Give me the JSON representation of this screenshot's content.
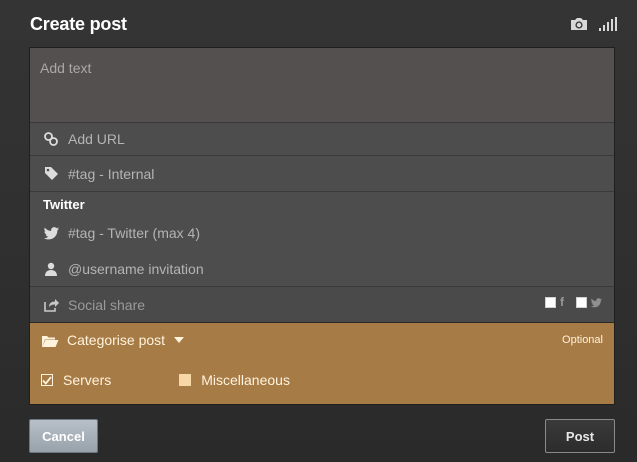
{
  "dialog": {
    "title": "Create post",
    "header_icons": [
      "camera-icon",
      "signal-icon"
    ]
  },
  "form": {
    "text_placeholder": "Add text",
    "url_placeholder": "Add URL",
    "tag_internal_placeholder": "#tag - Internal",
    "twitter": {
      "section_title": "Twitter",
      "tag_placeholder": "#tag - Twitter (max 4)",
      "username_placeholder": "@username invitation"
    },
    "social": {
      "label": "Social share",
      "facebook_icon_glyph": "f",
      "facebook_checked": false,
      "twitter_checked": false
    },
    "category": {
      "label": "Categorise post",
      "optional_label": "Optional",
      "options": [
        {
          "label": "Servers",
          "checked": true
        },
        {
          "label": "Miscellaneous",
          "checked": false
        }
      ]
    }
  },
  "actions": {
    "cancel_label": "Cancel",
    "post_label": "Post"
  },
  "colors": {
    "category_background": "#a67b46",
    "panel_background": "#4d4d4d",
    "cancel_button": "#a9b2ba"
  }
}
